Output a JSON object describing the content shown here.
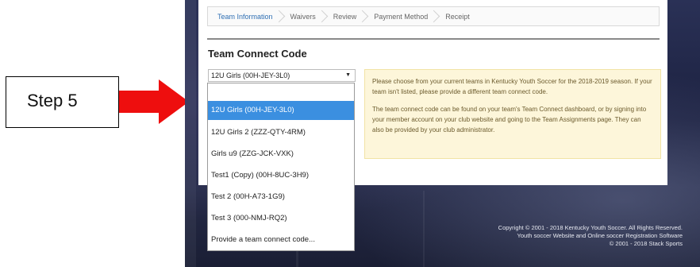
{
  "callout": {
    "label": "Step 5",
    "arrow_color": "#ee0e0e"
  },
  "tabs": [
    {
      "label": "Team Information",
      "active": true
    },
    {
      "label": "Waivers"
    },
    {
      "label": "Review"
    },
    {
      "label": "Payment Method"
    },
    {
      "label": "Receipt"
    }
  ],
  "section": {
    "heading": "Team Connect Code"
  },
  "select": {
    "value": "12U Girls (00H-JEY-3L0)"
  },
  "dropdown": {
    "options": [
      "12U Girls (00H-JEY-3L0)",
      "12U Girls 2 (ZZZ-QTY-4RM)",
      "Girls u9 (ZZG-JCK-VXK)",
      "Test1 (Copy) (00H-8UC-3H9)",
      "Test 2 (00H-A73-1G9)",
      "Test 3 (000-NMJ-RQ2)",
      "Provide a team connect code..."
    ],
    "selected_index": 0
  },
  "info": {
    "p1": "Please choose from your current teams in Kentucky Youth Soccer for the 2018-2019 season. If your team isn't listed, please provide a different team connect code.",
    "p2": "The team connect code can be found on your team's Team Connect dashboard, or by signing into your member account on your club website and going to the Team Assignments page. They can also be provided by your club administrator."
  },
  "footer": {
    "line1": "Copyright © 2001 - 2018 Kentucky Youth Soccer. All Rights Reserved.",
    "line2": "Youth soccer Website and Online soccer Registration Software",
    "line3": "© 2001 - 2018 Stack Sports"
  },
  "colors": {
    "accent": "#2f6fb3",
    "selected": "#3b8fe0",
    "info_bg": "#fdf6da"
  }
}
